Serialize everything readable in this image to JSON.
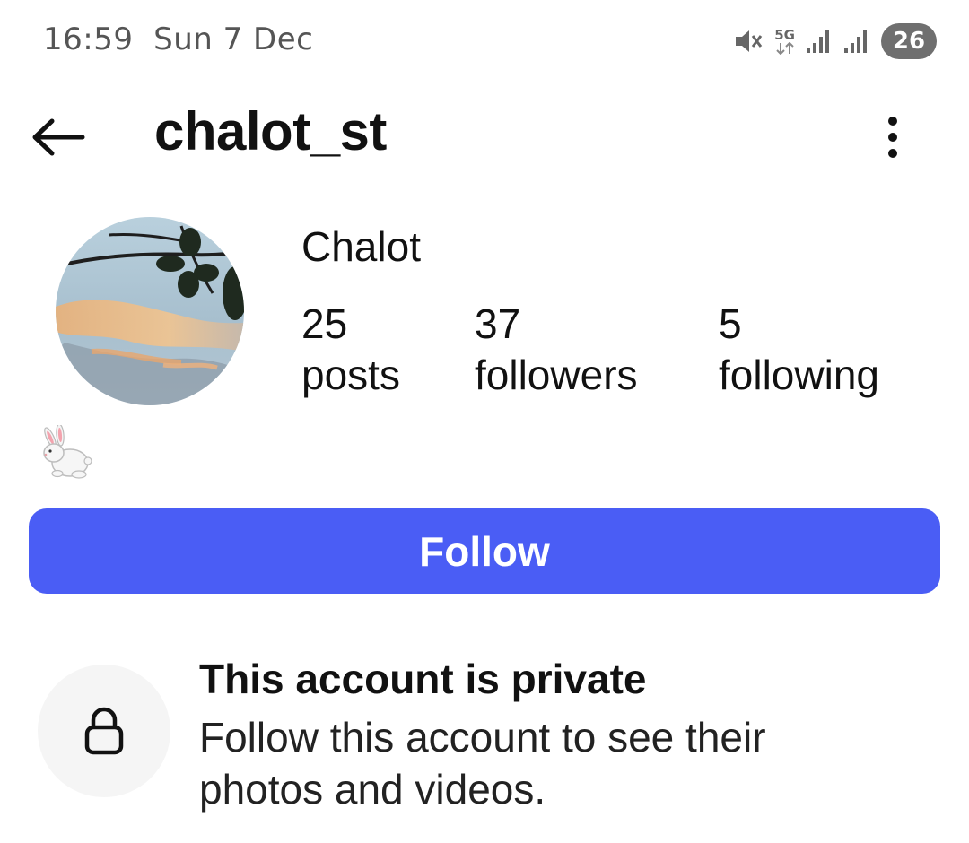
{
  "status_bar": {
    "time": "16:59",
    "date": "Sun 7 Dec",
    "network": "5G",
    "battery": "26",
    "icons": [
      "mute-icon",
      "5g-icon",
      "signal-icon",
      "signal-icon",
      "battery-icon"
    ]
  },
  "header": {
    "username": "chalot_st",
    "back_icon": "arrow-left-icon",
    "more_icon": "more-vertical-icon"
  },
  "profile": {
    "display_name": "Chalot",
    "stats": [
      {
        "value": "25",
        "label": "posts"
      },
      {
        "value": "37",
        "label": "followers"
      },
      {
        "value": "5",
        "label": "following"
      }
    ],
    "bio_icon": "rabbit-emoji-icon"
  },
  "follow_button": {
    "label": "Follow"
  },
  "private_notice": {
    "title": "This account is private",
    "description": "Follow this account to see their photos and videos.",
    "icon": "lock-icon"
  },
  "colors": {
    "accent": "#4a5df5",
    "text": "#111111",
    "muted": "#555555",
    "lock_bg": "#f5f5f5"
  }
}
